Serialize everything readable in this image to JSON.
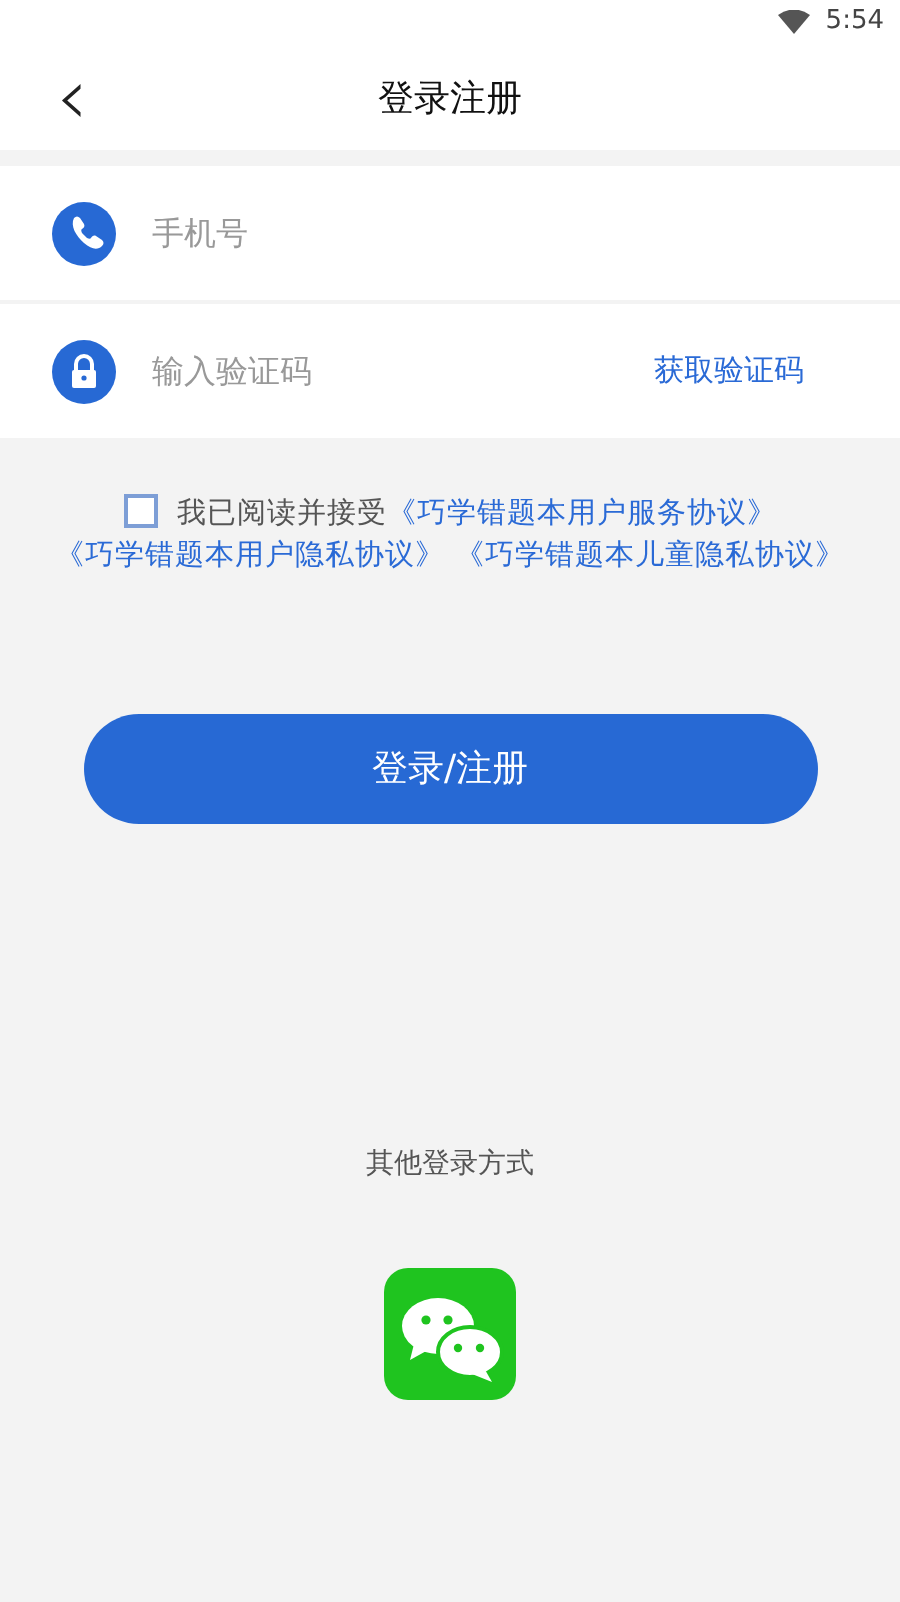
{
  "status_bar": {
    "time": "5:54"
  },
  "header": {
    "back": "‹",
    "title": "登录注册"
  },
  "fields": [
    {
      "kind": "phone",
      "placeholder": "手机号"
    },
    {
      "kind": "code",
      "placeholder": "输入验证码",
      "action": "获取验证码"
    }
  ],
  "agreement": {
    "checked": false,
    "prefix": "我已阅读并接受",
    "links": [
      "《巧学错题本用户服务协议》",
      "《巧学错题本用户隐私协议》",
      "《巧学错题本儿童隐私协议》"
    ]
  },
  "submit": "登录/注册",
  "other_login": {
    "label": "其他登录方式"
  }
}
